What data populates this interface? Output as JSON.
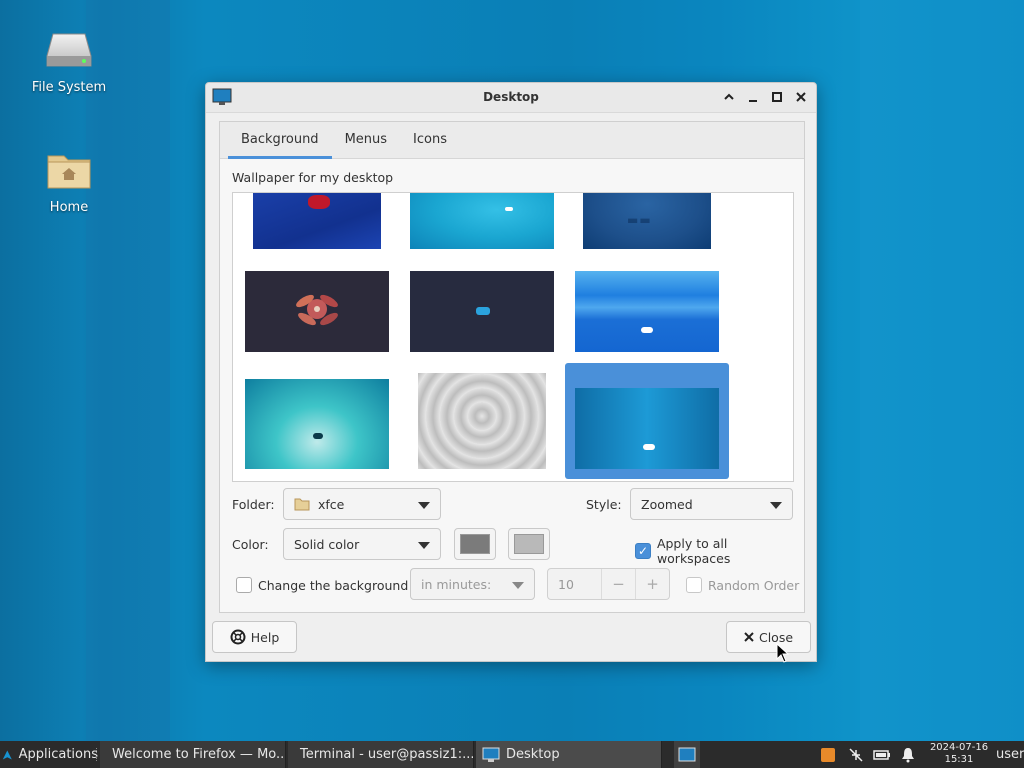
{
  "desktop": {
    "icons": [
      {
        "label": "File System",
        "icon": "drive-icon"
      },
      {
        "label": "Home",
        "icon": "home-folder-icon"
      }
    ]
  },
  "window": {
    "title": "Desktop",
    "tabs": [
      {
        "label": "Background",
        "active": true
      },
      {
        "label": "Menus",
        "active": false
      },
      {
        "label": "Icons",
        "active": false
      }
    ],
    "section_label": "Wallpaper for my desktop",
    "wallpapers": [
      {
        "id": "wp1",
        "colors": [
          "#12318f",
          "#1a3fa8",
          "#c0182a"
        ]
      },
      {
        "id": "wp2",
        "colors": [
          "#1aa6d1",
          "#0d84b8"
        ]
      },
      {
        "id": "wp3",
        "colors": [
          "#1d4f8a",
          "#0e3d74"
        ]
      },
      {
        "id": "wp4",
        "colors": [
          "#2c2a3a",
          "#c25a5a"
        ]
      },
      {
        "id": "wp5",
        "colors": [
          "#272b3f",
          "#2ba3de"
        ]
      },
      {
        "id": "wp6",
        "colors": [
          "#1f7fe0",
          "#56b2ef"
        ]
      },
      {
        "id": "wp7",
        "colors": [
          "#3ec5c8",
          "#0e7e9f"
        ]
      },
      {
        "id": "wp8",
        "colors": [
          "#d6d6d6",
          "#a8a8a8"
        ]
      },
      {
        "id": "wp9",
        "colors": [
          "#0f6da6",
          "#1d9ad6"
        ],
        "selected": true
      }
    ],
    "folder_label": "Folder:",
    "folder_value": "xfce",
    "style_label": "Style:",
    "style_value": "Zoomed",
    "color_label": "Color:",
    "color_value": "Solid color",
    "primary_color": "#7b7b7b",
    "secondary_color": "#b9b9b9",
    "apply_all_label": "Apply to all workspaces",
    "apply_all_checked": true,
    "change_bg_label": "Change the background",
    "change_bg_checked": false,
    "interval_value": "in minutes:",
    "interval_number": "10",
    "random_order_label": "Random Order",
    "help_label": "Help",
    "close_label": "Close"
  },
  "taskbar": {
    "applications_label": "Applications",
    "windows": [
      {
        "label": "Welcome to Firefox — Mo...",
        "icon": "firefox-icon"
      },
      {
        "label": "Terminal - user@passiz1:...",
        "icon": "terminal-icon"
      },
      {
        "label": "Desktop",
        "icon": "desktop-settings-icon",
        "active": true
      }
    ],
    "clock_date": "2024-07-16",
    "clock_time": "15:31",
    "user_label": "user"
  },
  "colors": {
    "accent": "#4a90d9",
    "taskbar": "#2b2b2b"
  }
}
